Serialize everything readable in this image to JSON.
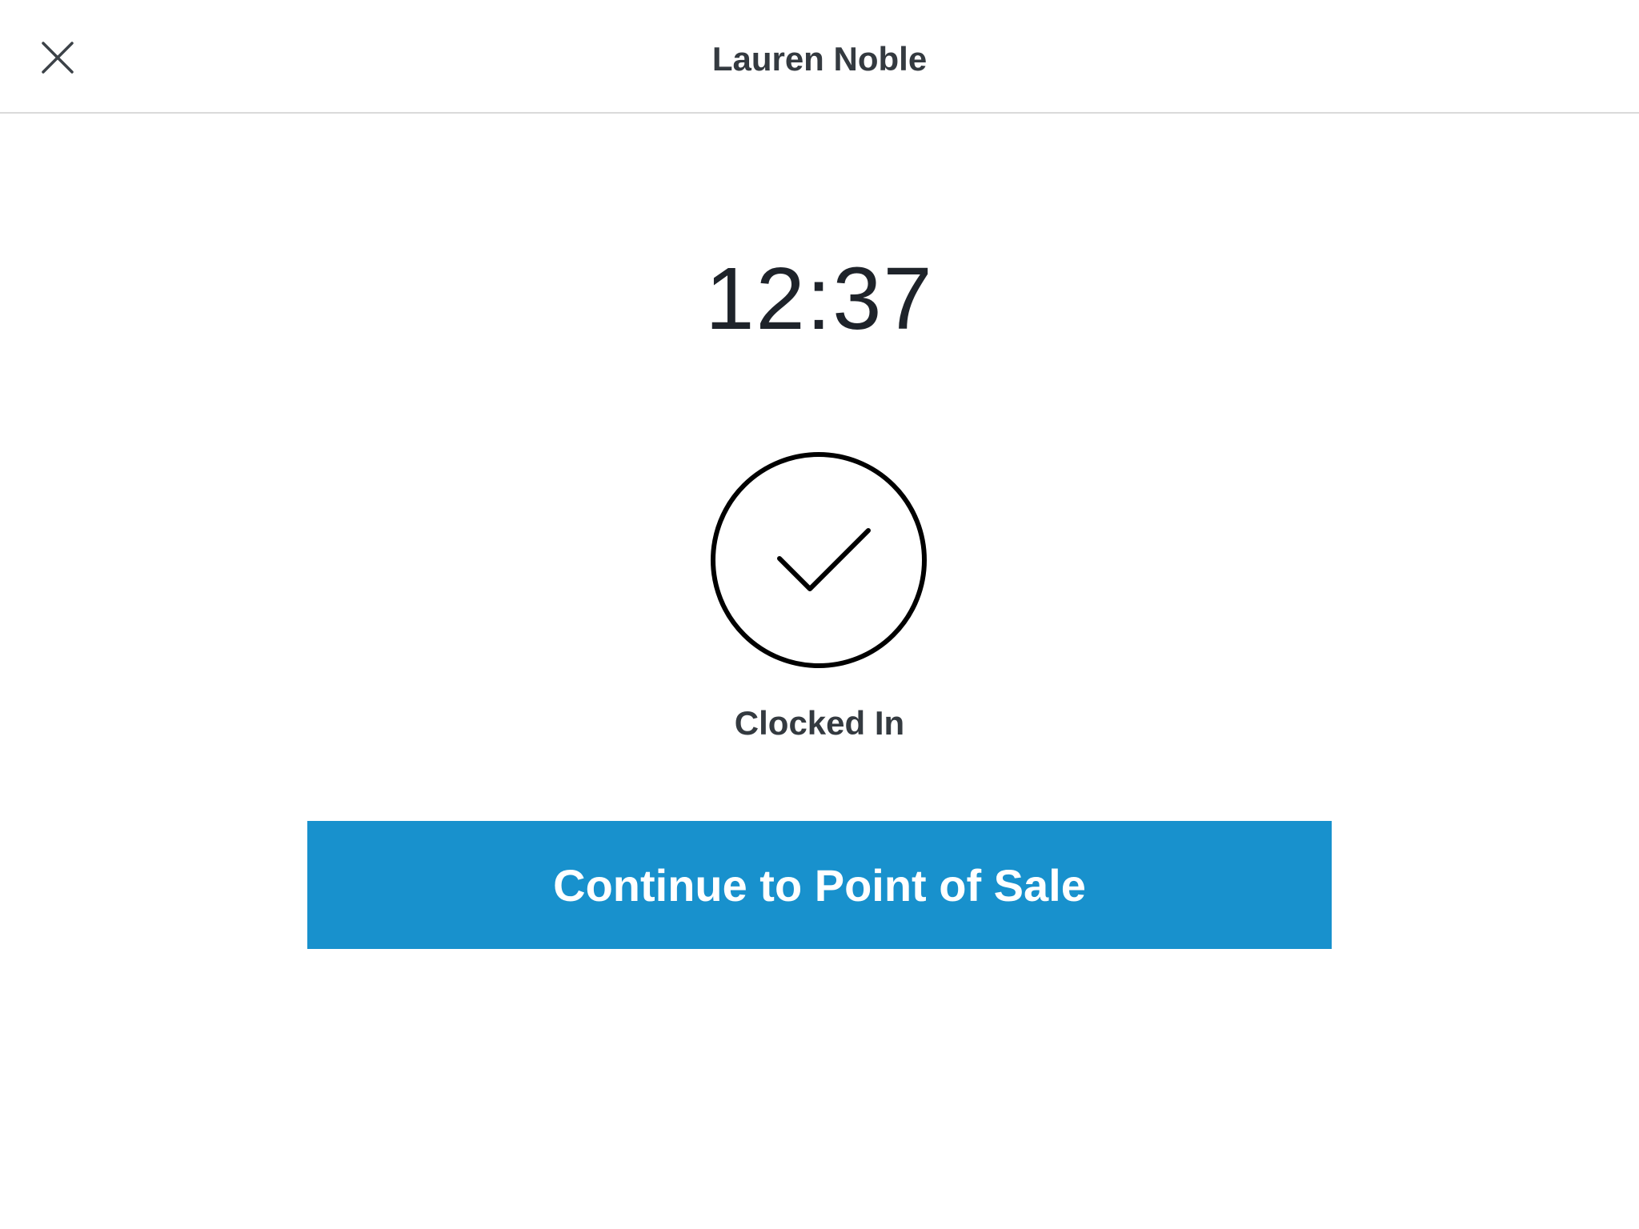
{
  "header": {
    "title": "Lauren Noble",
    "close_icon": "close-icon"
  },
  "main": {
    "time": "12:37",
    "status_icon": "checkmark-circle-icon",
    "status_label": "Clocked In",
    "continue_label": "Continue to Point of Sale"
  },
  "colors": {
    "accent": "#1891cd",
    "text_dark": "#343a40",
    "divider": "#dadada"
  }
}
